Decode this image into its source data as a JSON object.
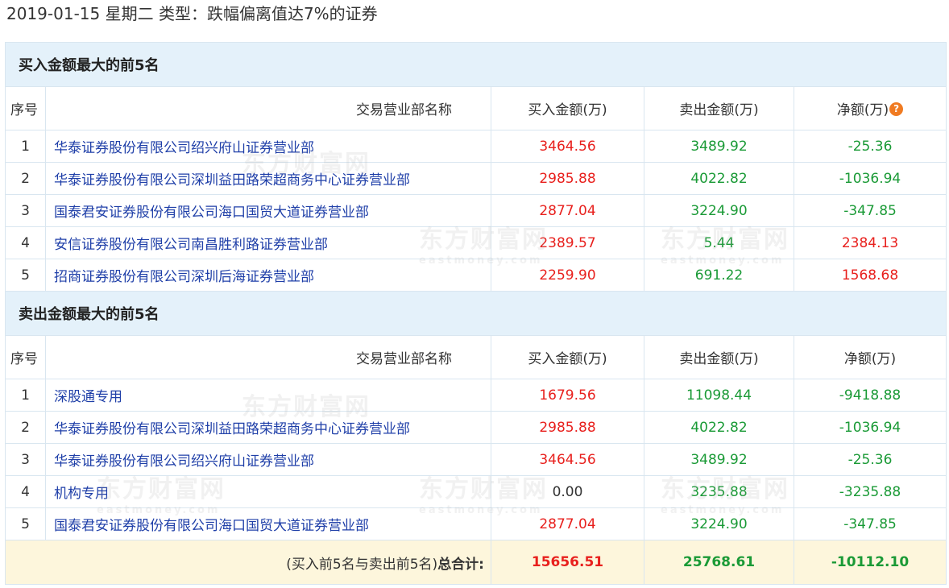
{
  "page": {
    "title": "2019-01-15 星期二  类型：跌幅偏离值达7%的证券"
  },
  "sections": [
    {
      "heading": "买入金额最大的前5名",
      "columns": [
        "序号",
        "交易营业部名称",
        "买入金额(万)",
        "卖出金额(万)",
        "净额(万)"
      ],
      "rows": [
        {
          "no": "1",
          "name": "华泰证券股份有限公司绍兴府山证券营业部",
          "buy": "3464.56",
          "sell": "3489.92",
          "net": "-25.36"
        },
        {
          "no": "2",
          "name": "华泰证券股份有限公司深圳益田路荣超商务中心证券营业部",
          "buy": "2985.88",
          "sell": "4022.82",
          "net": "-1036.94"
        },
        {
          "no": "3",
          "name": "国泰君安证券股份有限公司海口国贸大道证券营业部",
          "buy": "2877.04",
          "sell": "3224.90",
          "net": "-347.85"
        },
        {
          "no": "4",
          "name": "安信证券股份有限公司南昌胜利路证券营业部",
          "buy": "2389.57",
          "sell": "5.44",
          "net": "2384.13"
        },
        {
          "no": "5",
          "name": "招商证券股份有限公司深圳后海证券营业部",
          "buy": "2259.90",
          "sell": "691.22",
          "net": "1568.68"
        }
      ]
    },
    {
      "heading": "卖出金额最大的前5名",
      "columns": [
        "序号",
        "交易营业部名称",
        "买入金额(万)",
        "卖出金额(万)",
        "净额(万)"
      ],
      "rows": [
        {
          "no": "1",
          "name": "深股通专用",
          "buy": "1679.56",
          "sell": "11098.44",
          "net": "-9418.88"
        },
        {
          "no": "2",
          "name": "华泰证券股份有限公司深圳益田路荣超商务中心证券营业部",
          "buy": "2985.88",
          "sell": "4022.82",
          "net": "-1036.94"
        },
        {
          "no": "3",
          "name": "华泰证券股份有限公司绍兴府山证券营业部",
          "buy": "3464.56",
          "sell": "3489.92",
          "net": "-25.36"
        },
        {
          "no": "4",
          "name": "机构专用",
          "buy": "0.00",
          "sell": "3235.88",
          "net": "-3235.88"
        },
        {
          "no": "5",
          "name": "国泰君安证券股份有限公司海口国贸大道证券营业部",
          "buy": "2877.04",
          "sell": "3224.90",
          "net": "-347.85"
        }
      ]
    }
  ],
  "total": {
    "label_prefix": "(买入前5名与卖出前5名)",
    "label_bold": "总合计:",
    "buy": "15656.51",
    "sell": "25768.61",
    "net": "-10112.10"
  },
  "help_icon_glyph": "?",
  "watermark": {
    "cn": "东方财富网",
    "en": "eastmoney.com"
  },
  "colors": {
    "buy": "#e8201d",
    "sell": "#1a9a36",
    "positive_net": "#e8201d",
    "negative_net": "#1a9a36",
    "link": "#1f3fa8",
    "section_header_bg": "#e4f1fa",
    "total_bg": "#fdf6dc"
  }
}
